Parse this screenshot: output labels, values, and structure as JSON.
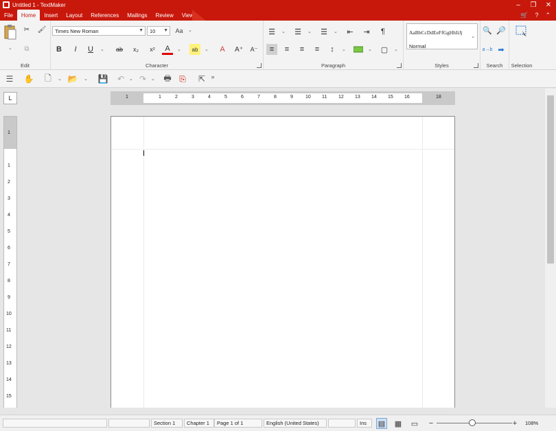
{
  "window": {
    "title": "Untitled 1 - TextMaker"
  },
  "menu": {
    "tabs": [
      {
        "label": "File"
      },
      {
        "label": "Home",
        "active": true
      },
      {
        "label": "Insert"
      },
      {
        "label": "Layout"
      },
      {
        "label": "References"
      },
      {
        "label": "Mailings"
      },
      {
        "label": "Review"
      },
      {
        "label": "View"
      }
    ]
  },
  "ribbon": {
    "groups": {
      "edit": "Edit",
      "character": "Character",
      "paragraph": "Paragraph",
      "styles": "Styles",
      "search": "Search",
      "selection": "Selection"
    },
    "font_name": "Times New Roman",
    "font_size": "10",
    "styles_preview": "AaBbCcDdEeFfGgHhIiJj",
    "style_name": "Normal"
  },
  "rulers": {
    "horizontal_ticks": [
      "1",
      "1",
      "2",
      "3",
      "4",
      "5",
      "6",
      "7",
      "8",
      "9",
      "10",
      "11",
      "12",
      "13",
      "14",
      "15",
      "16",
      "18"
    ],
    "vertical_ticks": [
      "1",
      "1",
      "2",
      "3",
      "4",
      "5",
      "6",
      "7",
      "8",
      "9",
      "10",
      "11",
      "12",
      "13",
      "14",
      "15"
    ]
  },
  "status": {
    "section": "Section 1",
    "chapter": "Chapter 1",
    "page": "Page 1 of 1",
    "language": "English (United States)",
    "mode": "Ins",
    "zoom": "108%"
  },
  "colors": {
    "accent": "#c8180c",
    "ribbon_bg": "#f3f3f3",
    "workspace_bg": "#e6e6e6"
  }
}
